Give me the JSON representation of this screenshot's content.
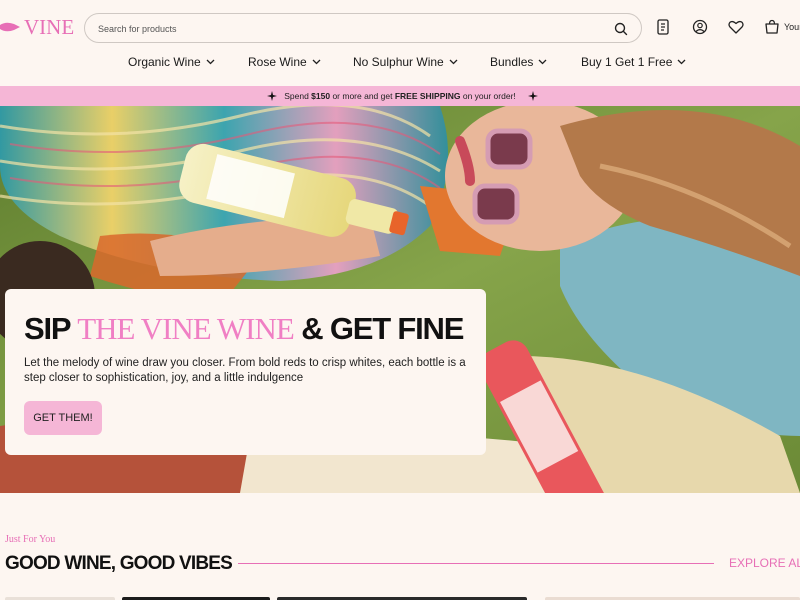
{
  "brand": {
    "name": "VINE",
    "accent_color": "#e76fb6",
    "promo_color": "#f5b6d6"
  },
  "search": {
    "placeholder": "Search for products",
    "icon": "search-icon"
  },
  "header_icons": [
    "receipt-icon",
    "account-icon",
    "heart-icon",
    "bag-icon"
  ],
  "cart": {
    "label": "Your"
  },
  "nav": [
    {
      "label": "Organic Wine"
    },
    {
      "label": "Rose Wine"
    },
    {
      "label": "No Sulphur Wine"
    },
    {
      "label": "Bundles"
    },
    {
      "label": "Buy 1 Get 1 Free"
    }
  ],
  "promo": {
    "prefix": "Spend ",
    "amount": "$150",
    "middle": " or more and get ",
    "highlight": "FREE SHIPPING",
    "suffix": " on your order!"
  },
  "hero": {
    "title_start": "SIP ",
    "title_accent": "THE VINE WINE",
    "title_end": " & GET FINE",
    "subtitle": "Let the melody of wine draw you closer. From bold reds to crisp whites, each bottle is a step closer to sophistication, joy, and a little indulgence",
    "button": "GET THEM!"
  },
  "section": {
    "eyebrow": "Just For You",
    "title": "GOOD WINE, GOOD VIBES",
    "link": "EXPLORE ALL"
  }
}
